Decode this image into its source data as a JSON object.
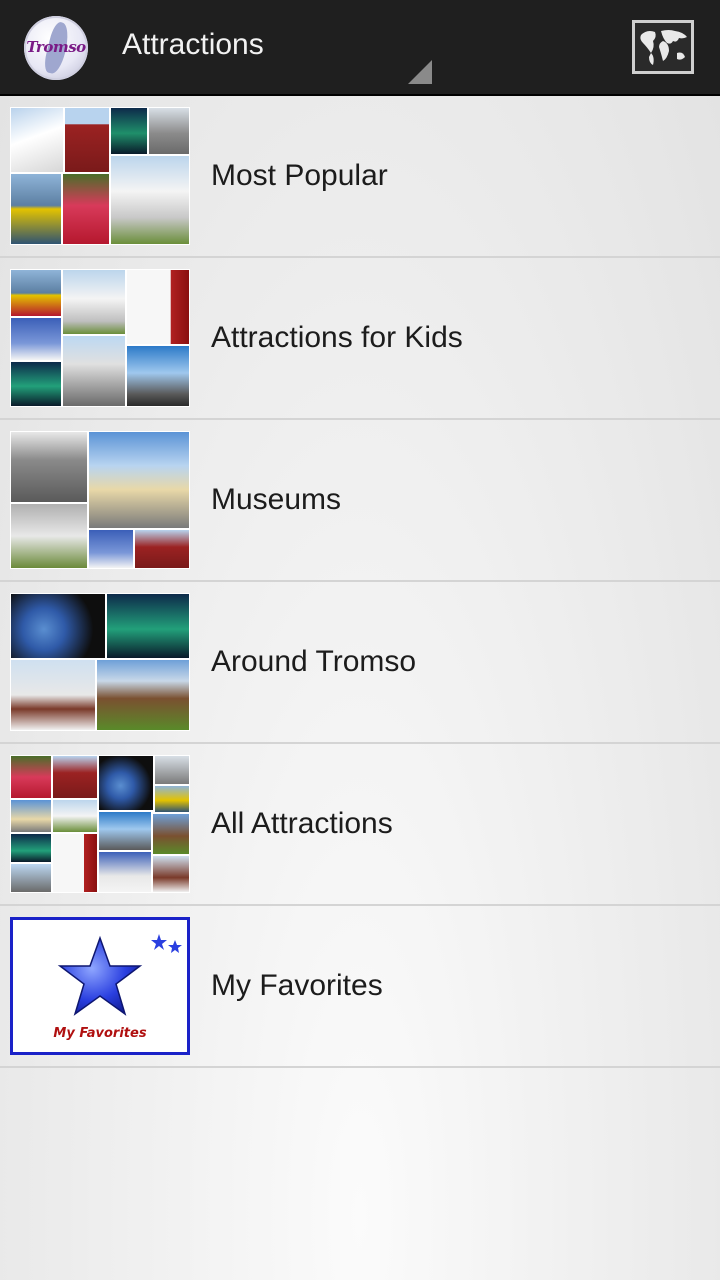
{
  "actionbar": {
    "title": "Attractions",
    "logo_text": "Tromso",
    "map_icon": "world-map-icon"
  },
  "categories": [
    {
      "label": "Most Popular"
    },
    {
      "label": "Attractions for Kids"
    },
    {
      "label": "Museums"
    },
    {
      "label": "Around Tromso"
    },
    {
      "label": "All Attractions"
    },
    {
      "label": "My Favorites",
      "thumb_text": "My Favorites"
    }
  ],
  "colors": {
    "actionbar_bg": "#1f1f1f",
    "favorites_border": "#1a22c8",
    "favorites_star": "#2a3fe0"
  }
}
